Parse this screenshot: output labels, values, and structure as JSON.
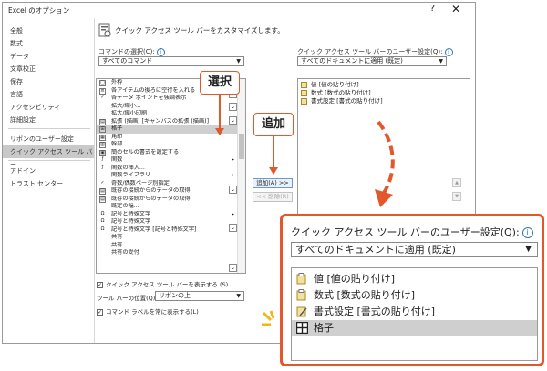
{
  "window": {
    "title": "Excel のオプション",
    "help": "?",
    "close": "✕"
  },
  "nav": {
    "items": [
      {
        "label": "全般"
      },
      {
        "label": "数式"
      },
      {
        "label": "データ"
      },
      {
        "label": "文章校正"
      },
      {
        "label": "保存"
      },
      {
        "label": "言語"
      },
      {
        "label": "アクセシビリティ"
      },
      {
        "label": "詳細設定"
      },
      {
        "label": "リボンのユーザー設定"
      },
      {
        "label": "クイック アクセス ツール バー"
      },
      {
        "label": "アドイン"
      },
      {
        "label": "トラスト センター"
      }
    ]
  },
  "header": {
    "text": "クイック アクセス ツール バーをカスタマイズします。"
  },
  "left": {
    "label": "コマンドの選択(C):",
    "select": "すべてのコマンド",
    "items": [
      {
        "label": "外枠",
        "icon": "▢",
        "sub": ""
      },
      {
        "label": "各アイテムの後ろに空行を入れる",
        "icon": "≡",
        "sub": ""
      },
      {
        "label": "各データ ポイントを強調表示",
        "icon": "✓",
        "sub": ""
      },
      {
        "label": "拡大/縮小...",
        "icon": "",
        "sub": ""
      },
      {
        "label": "拡大/縮小印刷",
        "icon": "",
        "sub": ""
      },
      {
        "label": "拡張 (描画) [キャンバスの拡張 (描画)]",
        "icon": "▤",
        "sub": ""
      },
      {
        "label": "格子",
        "icon": "⊞",
        "sub": ""
      },
      {
        "label": "角印",
        "icon": "▦",
        "sub": ""
      },
      {
        "label": "幹部",
        "icon": "▥",
        "sub": ""
      },
      {
        "label": "簡のセルの書式を設定する",
        "icon": "▣",
        "sub": ""
      },
      {
        "label": "関数",
        "icon": "ƒ",
        "sub": "▸"
      },
      {
        "label": "関数の挿入...",
        "icon": "ƒ",
        "sub": ""
      },
      {
        "label": "関数ライブラリ",
        "icon": "",
        "sub": "▸"
      },
      {
        "label": "奇数/偶数ページ別指定",
        "icon": "✓",
        "sub": ""
      },
      {
        "label": "既存の接続からのデータの取得",
        "icon": "▤",
        "sub": ""
      },
      {
        "label": "既存の接続からのデータの取得",
        "icon": "▤",
        "sub": ""
      },
      {
        "label": "既定の幅...",
        "icon": "",
        "sub": ""
      },
      {
        "label": "記号と特殊文字",
        "icon": "Ω",
        "sub": "▸"
      },
      {
        "label": "記号と特殊文字",
        "icon": "Ω",
        "sub": ""
      },
      {
        "label": "記号と特殊文字 [記号と特殊文字]",
        "icon": "Ω",
        "sub": ""
      },
      {
        "label": "共有",
        "icon": "",
        "sub": ""
      },
      {
        "label": "共有",
        "icon": "",
        "sub": ""
      },
      {
        "label": "共有の受付",
        "icon": "",
        "sub": ""
      }
    ]
  },
  "middle": {
    "add": "追加(A) >>",
    "remove": "<< 削除(R)"
  },
  "right": {
    "label": "クイック アクセス ツール バーのユーザー設定(Q):",
    "select": "すべてのドキュメントに適用 (既定)",
    "items": [
      {
        "label": "値 [値の貼り付け]"
      },
      {
        "label": "数式 [数式の貼り付け]"
      },
      {
        "label": "書式設定 [書式の貼り付け]"
      }
    ]
  },
  "bottom": {
    "show_below": "クイック アクセス ツール バーを表示する (S)",
    "position_label": "ツール バーの位置(Q)",
    "position_value": "リボンの上",
    "show_labels": "コマンド ラベルを常に表示する(L)"
  },
  "callouts": {
    "select": "選択",
    "add": "追加"
  },
  "zoom": {
    "label": "クイック アクセス ツール バーのユーザー設定(Q):",
    "select": "すべてのドキュメントに適用 (既定)",
    "items": [
      {
        "label": "値 [値の貼り付け]"
      },
      {
        "label": "数式 [数式の貼り付け]"
      },
      {
        "label": "書式設定 [書式の貼り付け]"
      },
      {
        "label": "格子"
      }
    ]
  },
  "colors": {
    "accent": "#e2572b",
    "selection": "#cfcfcf",
    "info": "#2b78c2"
  }
}
